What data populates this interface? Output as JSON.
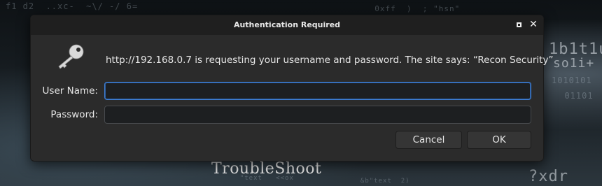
{
  "background": {
    "code_lines": [
      "f1 d2  ..xc-  ~\\/ -/ 6=",
      "  0xff  )  ; \"hsn\"",
      "1b1t1u",
      "so1i+",
      "1010101   ",
      "  01101",
      "?xdr",
      "  \"text   <<ox",
      "       &b\"text  2)"
    ],
    "watermark": "TroubleShoot"
  },
  "dialog": {
    "title": "Authentication Required",
    "message": "http://192.168.0.7 is requesting your username and password. The site says: “Recon Security”",
    "fields": {
      "username_label": "User Name:",
      "username_value": "",
      "password_label": "Password:",
      "password_value": ""
    },
    "buttons": {
      "cancel": "Cancel",
      "ok": "OK"
    },
    "icons": {
      "key": "key-icon",
      "maximize": "maximize-icon",
      "close": "close-icon"
    },
    "colors": {
      "focus_accent": "#3f7fd6",
      "dialog_bg": "#2b2b2b",
      "titlebar_bg": "#1f1f1f"
    }
  }
}
